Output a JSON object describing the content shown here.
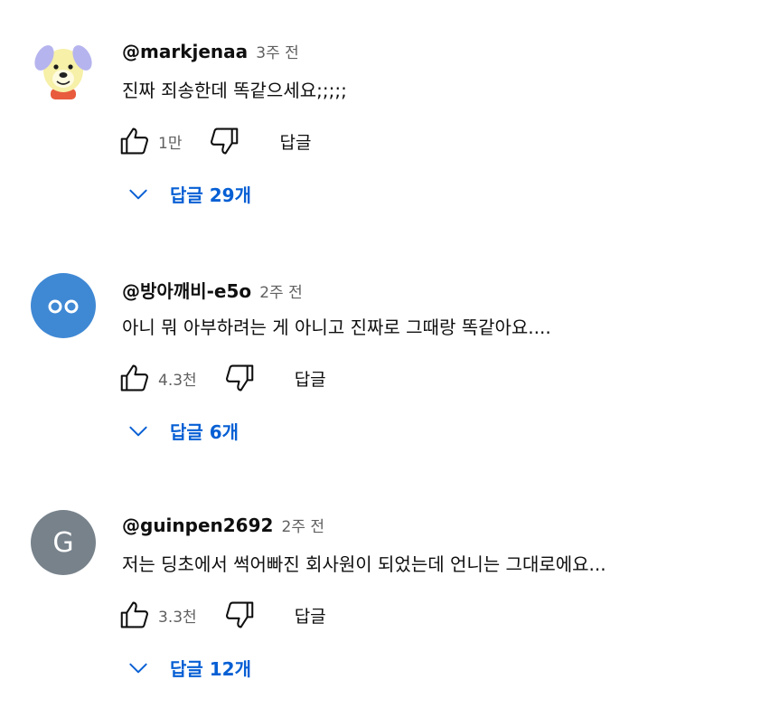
{
  "comments": [
    {
      "author": "@markjenaa",
      "time": "3주 전",
      "text": "진짜 죄송한데 똑같으세요;;;;;",
      "likes": "1만",
      "reply_label": "답글",
      "replies_label": "답글 29개",
      "avatar_icon": "dog-character-avatar"
    },
    {
      "author": "@방아깨비-e5o",
      "time": "2주 전",
      "text": "아니 뭐 아부하려는 게 아니고 진짜로 그때랑 똑같아요....",
      "likes": "4.3천",
      "reply_label": "답글",
      "replies_label": "답글 6개",
      "avatar_icon": "eyes-avatar",
      "avatar_color": "#3f88d4"
    },
    {
      "author": "@guinpen2692",
      "time": "2주 전",
      "text": "저는 딩초에서 썩어빠진 회사원이 되었는데 언니는 그대로에요...",
      "likes": "3.3천",
      "reply_label": "답글",
      "replies_label": "답글 12개",
      "avatar_letter": "G",
      "avatar_color": "#77828b"
    }
  ],
  "colors": {
    "accent": "#065fd4",
    "secondary_text": "#606060",
    "primary_text": "#0f0f0f"
  }
}
